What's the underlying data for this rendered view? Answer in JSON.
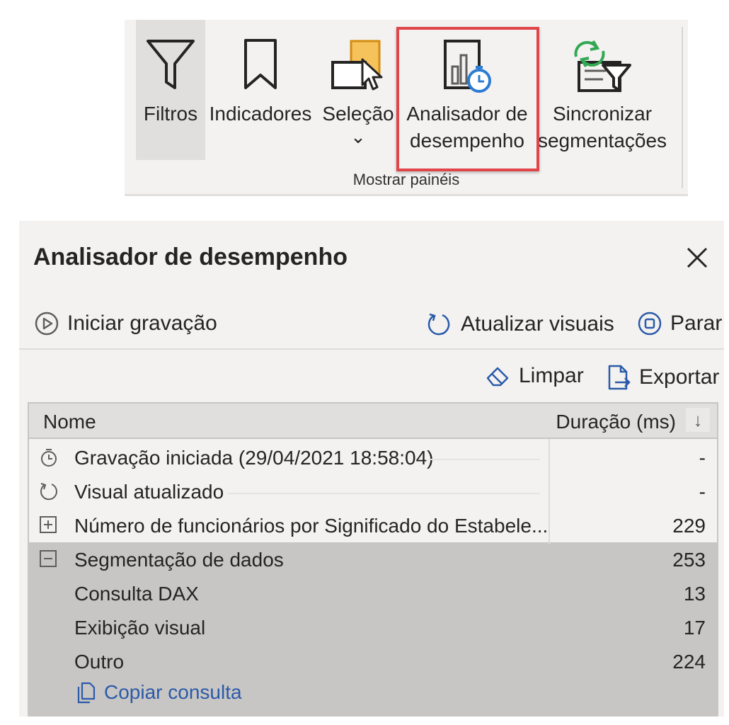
{
  "ribbon": {
    "buttons": [
      {
        "label": "Filtros",
        "icon": "filter-icon"
      },
      {
        "label": "Indicadores",
        "icon": "bookmark-icon"
      },
      {
        "label": "Seleção",
        "icon": "selection-icon",
        "dropdown": "⌄"
      },
      {
        "label": "Analisador de\ndesempenho",
        "icon": "performance-analyzer-icon"
      },
      {
        "label": "Sincronizar\nsegmentações",
        "icon": "sync-slicers-icon"
      }
    ],
    "group_label": "Mostrar painéis"
  },
  "pane": {
    "title": "Analisador de desempenho",
    "start_recording": "Iniciar gravação",
    "refresh_visuals": "Atualizar visuais",
    "stop": "Parar",
    "clear": "Limpar",
    "export": "Exportar"
  },
  "table": {
    "columns": {
      "name": "Nome",
      "duration": "Duração (ms)",
      "sort": "↓"
    },
    "rows": [
      {
        "icon": "stopwatch-icon",
        "label": "Gravação iniciada (29/04/2021 18:58:04)",
        "value": "-"
      },
      {
        "icon": "refresh-icon",
        "label": "Visual atualizado",
        "value": "-"
      },
      {
        "icon": "expand-icon",
        "label": "Número de funcionários por Significado do Estabele...",
        "value": "229"
      },
      {
        "icon": "collapse-icon",
        "label": "Segmentação de dados",
        "value": "253"
      },
      {
        "icon": "",
        "label": "Consulta DAX",
        "value": "13"
      },
      {
        "icon": "",
        "label": "Exibição visual",
        "value": "17"
      },
      {
        "icon": "",
        "label": "Outro",
        "value": "224"
      }
    ],
    "copy_query": "Copiar consulta"
  },
  "colors": {
    "highlight": "#e0454a",
    "link": "#2b5aa8",
    "selection": "#c8c6c4"
  }
}
